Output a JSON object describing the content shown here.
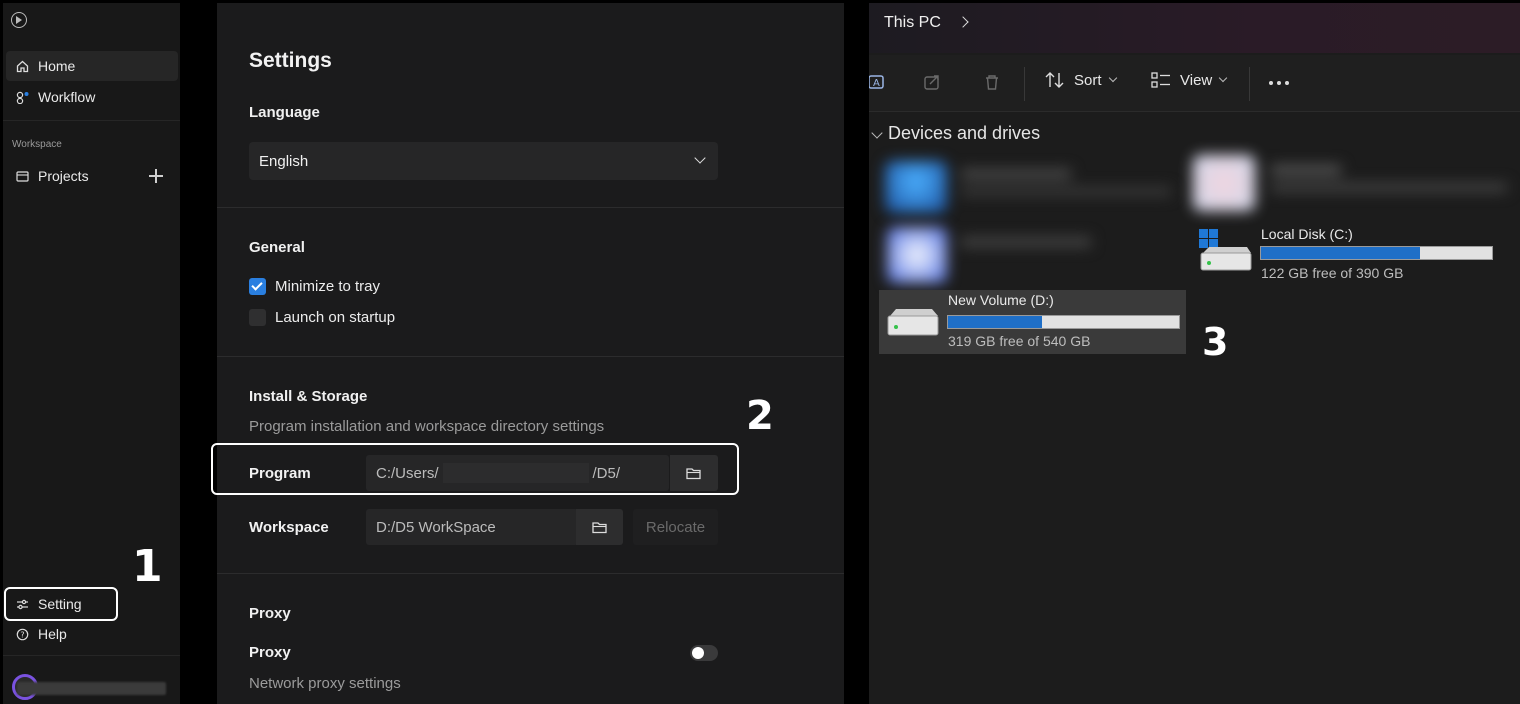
{
  "sidebar": {
    "items": [
      {
        "label": "Home",
        "icon": "home-icon"
      },
      {
        "label": "Workflow",
        "icon": "workflow-icon"
      }
    ],
    "workspace_label": "Workspace",
    "projects_label": "Projects",
    "setting_label": "Setting",
    "help_label": "Help"
  },
  "settings": {
    "title": "Settings",
    "language": {
      "heading": "Language",
      "value": "English"
    },
    "general": {
      "heading": "General",
      "minimize_to_tray": {
        "label": "Minimize to tray",
        "checked": true
      },
      "launch_on_startup": {
        "label": "Launch on startup",
        "checked": false
      }
    },
    "install": {
      "heading": "Install & Storage",
      "description": "Program installation and workspace directory settings",
      "program_label": "Program",
      "program_path_start": "C:/Users/",
      "program_path_end": "/D5/",
      "workspace_label": "Workspace",
      "workspace_path": "D:/D5 WorkSpace",
      "relocate_label": "Relocate"
    },
    "proxy": {
      "heading": "Proxy",
      "label": "Proxy",
      "description": "Network proxy settings",
      "enabled": false
    }
  },
  "explorer": {
    "title": "This PC",
    "toolbar": {
      "sort_label": "Sort",
      "view_label": "View"
    },
    "group_title": "Devices and drives",
    "drives": [
      {
        "name": "Local Disk (C:)",
        "free_text": "122 GB free of 390 GB",
        "used_fraction": 0.687
      },
      {
        "name": "New Volume (D:)",
        "free_text": "319 GB free of 540 GB",
        "used_fraction": 0.409
      }
    ]
  },
  "annotations": [
    "1",
    "2",
    "3"
  ],
  "colors": {
    "accent": "#2a7fe0",
    "drive_bar": "#1f6fc7",
    "avatar_ring": "#7a52e0"
  }
}
